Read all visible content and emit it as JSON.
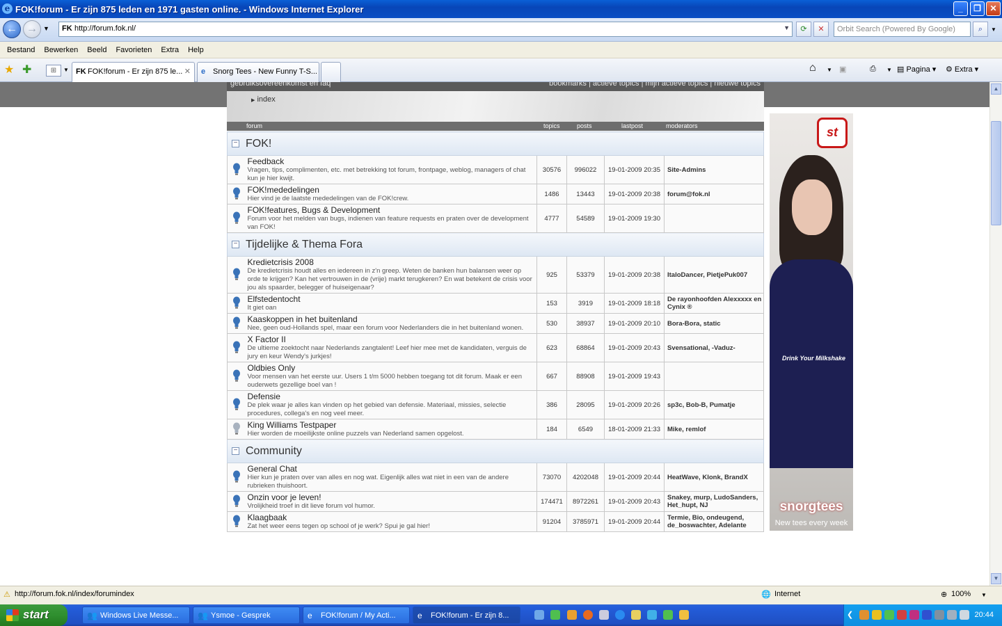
{
  "window": {
    "title": "FOK!forum - Er zijn 875 leden en 1971 gasten online. - Windows Internet Explorer"
  },
  "address": {
    "url": "http://forum.fok.nl/",
    "search_placeholder": "Orbit Search (Powered By Google)"
  },
  "menu": [
    "Bestand",
    "Bewerken",
    "Beeld",
    "Favorieten",
    "Extra",
    "Help"
  ],
  "tabs": [
    {
      "label": "FOK!forum - Er zijn 875 le..."
    },
    {
      "label": "Snorg Tees - New Funny T-S..."
    }
  ],
  "commandbar": {
    "page": "Pagina",
    "extra": "Extra"
  },
  "forum": {
    "toplinks_left": "gebruiksovereenkomst en faq",
    "toplinks_right": "bookmarks | actieve topics | mijn actieve topics | nieuwe topics",
    "breadcrumb": "index",
    "columns": {
      "forum": "forum",
      "topics": "topics",
      "posts": "posts",
      "lastpost": "lastpost",
      "moderators": "moderators"
    },
    "sections": [
      {
        "title": "FOK!",
        "rows": [
          {
            "name": "Feedback",
            "desc": "Vragen, tips, complimenten, etc. met betrekking tot forum, frontpage, weblog, managers of chat kun je hier kwijt.",
            "topics": "30576",
            "posts": "996022",
            "last": "19-01-2009 20:35",
            "mods": "Site-Admins",
            "new": true
          },
          {
            "name": "FOK!mededelingen",
            "desc": "Hier vind je de laatste mededelingen van de FOK!crew.",
            "topics": "1486",
            "posts": "13443",
            "last": "19-01-2009 20:38",
            "mods": "forum@fok.nl",
            "new": true
          },
          {
            "name": "FOK!features, Bugs & Development",
            "desc": "Forum voor het melden van bugs, indienen van feature requests en praten over de development van FOK!",
            "topics": "4777",
            "posts": "54589",
            "last": "19-01-2009 19:30",
            "mods": "",
            "new": true
          }
        ]
      },
      {
        "title": "Tijdelijke & Thema Fora",
        "rows": [
          {
            "name": "Kredietcrisis 2008",
            "desc": "De kredietcrisis houdt alles en iedereen in z'n greep. Weten de banken hun balansen weer op orde te krijgen? Kan het vertrouwen in de (vrije) markt terugkeren? En wat betekent de crisis voor jou als spaarder, belegger of huiseigenaar?",
            "topics": "925",
            "posts": "53379",
            "last": "19-01-2009 20:38",
            "mods": "ItaloDancer, PietjePuk007",
            "new": true
          },
          {
            "name": "Elfstedentocht",
            "desc": "It giet oan",
            "topics": "153",
            "posts": "3919",
            "last": "19-01-2009 18:18",
            "mods": "De rayonhoofden Alexxxxx en Cynix ®",
            "new": true
          },
          {
            "name": "Kaaskoppen in het buitenland",
            "desc": "Nee, geen oud-Hollands spel, maar een forum voor Nederlanders die in het buitenland wonen.",
            "topics": "530",
            "posts": "38937",
            "last": "19-01-2009 20:10",
            "mods": "Bora-Bora, static",
            "new": true
          },
          {
            "name": "X Factor II",
            "desc": "De ultieme zoektocht naar Nederlands zangtalent! Leef hier mee met de kandidaten, verguis de jury en keur Wendy's jurkjes!",
            "topics": "623",
            "posts": "68864",
            "last": "19-01-2009 20:43",
            "mods": "Svensational, -Vaduz-",
            "new": true
          },
          {
            "name": "Oldbies Only",
            "desc": "Voor mensen van het eerste uur. Users 1 t/m 5000 hebben toegang tot dit forum. Maak er een ouderwets gezellige boel van !",
            "topics": "667",
            "posts": "88908",
            "last": "19-01-2009 19:43",
            "mods": "",
            "new": true
          },
          {
            "name": "Defensie",
            "desc": "De plek waar je alles kan vinden op het gebied van defensie. Materiaal, missies, selectie procedures, collega's en nog veel meer.",
            "topics": "386",
            "posts": "28095",
            "last": "19-01-2009 20:26",
            "mods": "sp3c, Bob-B, Pumatje",
            "new": true
          },
          {
            "name": "King Williams Testpaper",
            "desc": "Hier worden de moeilijkste online puzzels van Nederland samen opgelost.",
            "topics": "184",
            "posts": "6549",
            "last": "18-01-2009 21:33",
            "mods": "Mike, remlof",
            "new": false
          }
        ]
      },
      {
        "title": "Community",
        "rows": [
          {
            "name": "General Chat",
            "desc": "Hier kun je praten over van alles en nog wat. Eigenlijk alles wat niet in een van de andere rubrieken thuishoort.",
            "topics": "73070",
            "posts": "4202048",
            "last": "19-01-2009 20:44",
            "mods": "HeatWave, Klonk, BrandX",
            "new": true
          },
          {
            "name": "Onzin voor je leven!",
            "desc": "Vrolijkheid troef in dit lieve forum vol humor.",
            "topics": "174471",
            "posts": "8972261",
            "last": "19-01-2009 20:43",
            "mods": "Snakey, murp, LudoSanders, Het_hupt, NJ",
            "new": true
          },
          {
            "name": "Klaagbaak",
            "desc": "Zat het weer eens tegen op school of je werk? Spui je gal hier!",
            "topics": "91204",
            "posts": "3785971",
            "last": "19-01-2009 20:44",
            "mods": "Termie, Bio, ondeugend, de_boswachter, Adelante",
            "new": true
          }
        ]
      }
    ]
  },
  "ad": {
    "logo": "st",
    "slogan": "Drink Your Milkshake",
    "brand": "snorgtees",
    "tagline": "New tees every week"
  },
  "status": {
    "url": "http://forum.fok.nl/index/forumindex",
    "zone": "Internet",
    "zoom": "100%"
  },
  "taskbar": {
    "start": "start",
    "items": [
      "Windows Live Messe...",
      "Ysmoe - Gesprek",
      "FOK!forum / My Acti...",
      "FOK!forum - Er zijn 8..."
    ],
    "clock": "20:44"
  },
  "colors": {
    "title_blue": "#0a4ec4",
    "section_bg": "#dde7f3",
    "start_green": "#2f8f2f"
  }
}
